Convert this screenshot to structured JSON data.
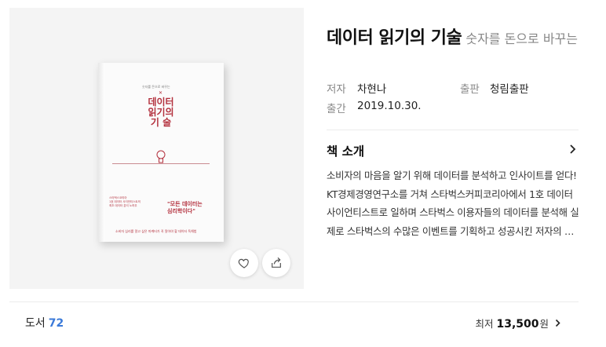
{
  "book": {
    "title": "데이터 읽기의 기술",
    "subtitle": "숫자를 돈으로 바꾸는",
    "author_label": "저자",
    "author": "차현나",
    "publisher_label": "출판",
    "publisher": "청림출판",
    "date_label": "출간",
    "date": "2019.10.30."
  },
  "cover": {
    "top_text": "숫자를 돈으로 바꾸는",
    "title_lines": [
      "데이터",
      "읽기의",
      "기 술"
    ],
    "quote_lines": [
      "\"모든 데이터는",
      "심리학이다\""
    ],
    "blurb_lines": [
      "스타벅스코리아",
      "1호 데이터 사이언티스트의",
      "최초 데이터 분석 노하우"
    ],
    "bottom_text": "소비자 심리를 알고 싶은 마케터가 꼭 알아야 할 데이터 독해법",
    "colors": {
      "accent": "#b3303d"
    }
  },
  "actions": {
    "like_icon": "heart-icon",
    "share_icon": "share-icon"
  },
  "intro": {
    "title": "책 소개",
    "text": "소비자의 마음을 알기 위해 데이터를 분석하고 인사이트를 얻다! KT경제경영연구소를 거쳐 스타벅스커피코리아에서 1호 데이터 사이언티스트로 일하며 스타벅스 이용자들의 데이터를 분석해 실제로 스타벅스의 수많은 이벤트를 기획하고 성공시킨 저자의 노하우를 담았다."
  },
  "footer": {
    "category": "도서",
    "count": "72",
    "lowest_label": "최저",
    "price": "13,500",
    "currency": "원"
  }
}
